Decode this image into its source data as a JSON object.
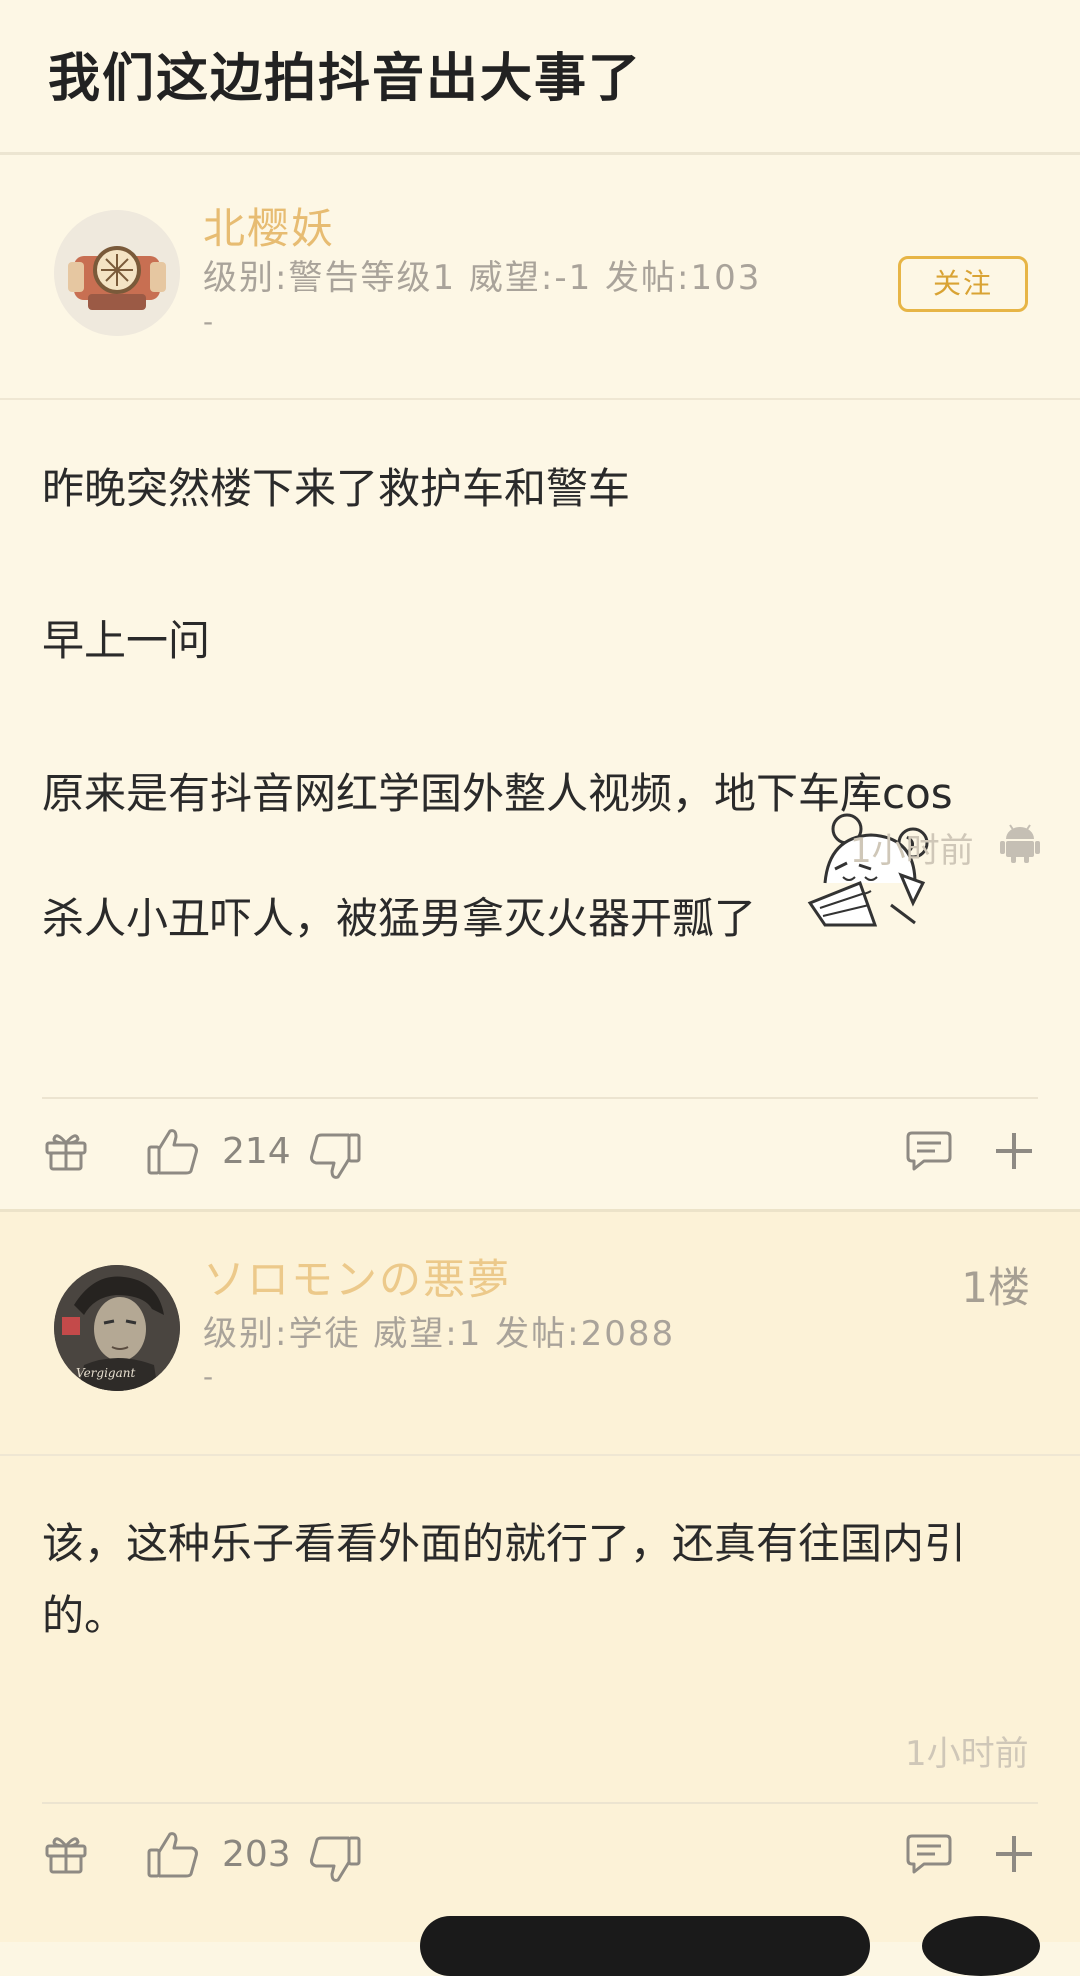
{
  "thread": {
    "title": "我们这边拍抖音出大事了"
  },
  "op": {
    "username": "北樱妖",
    "meta": "级别:警告等级1 威望:-1 发帖:103",
    "meta_extra": "-",
    "follow_label": "关注",
    "body": [
      "昨晚突然楼下来了救护车和警车",
      "早上一问",
      "原来是有抖音网红学国外整人视频，地下车库cos",
      "杀人小丑吓人，被猛男拿灭火器开瓢了"
    ],
    "timestamp": "1小时前",
    "likes": "214",
    "icons": [
      "gift-icon",
      "thumbs-up-icon",
      "thumbs-down-icon",
      "comment-icon",
      "plus-icon",
      "android-icon"
    ]
  },
  "reply": {
    "username": "ソロモンの悪夢",
    "floor": "1楼",
    "meta": "级别:学徒 威望:1 发帖:2088",
    "meta_extra": "-",
    "body": [
      "该，这种乐子看看外面的就行了，还真有往国内引",
      "的。"
    ],
    "timestamp": "1小时前",
    "likes": "203"
  },
  "colors": {
    "background": "#fcf6e3",
    "username": "#e7bc72",
    "follow_border": "#e7b546",
    "muted_text": "#a9a39a"
  }
}
